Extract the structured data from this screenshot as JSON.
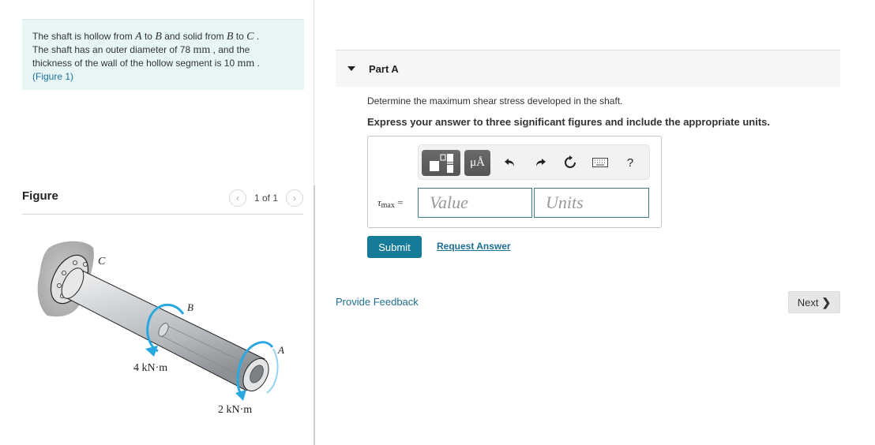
{
  "problem": {
    "line1_pre": "The shaft is hollow from ",
    "var_a": "A",
    "line1_mid1": " to ",
    "var_b": "B",
    "line1_mid2": " and solid from ",
    "var_b2": "B",
    "line1_mid3": " to ",
    "var_c": "C",
    "line1_end": " .",
    "line2_pre": "The shaft has an outer diameter of 78 ",
    "unit_mm": "mm",
    "line2_end": " , and the",
    "line3_pre": "thickness of the wall of the hollow segment is 10 ",
    "unit_mm2": "mm",
    "line3_end": " .",
    "figure_link": "(Figure 1)"
  },
  "figure": {
    "title": "Figure",
    "pager_text": "1 of 1",
    "prev_icon": "‹",
    "next_icon": "›",
    "labels": {
      "c": "C",
      "b": "B",
      "a": "A",
      "torque_b": "4 kN·m",
      "torque_a": "2 kN·m"
    }
  },
  "part": {
    "title": "Part A",
    "question": "Determine the maximum shear stress developed in the shaft.",
    "instructions": "Express your answer to three significant figures and include the appropriate units."
  },
  "answer": {
    "lhs_symbol": "τ",
    "lhs_sub": "max",
    "lhs_eq": " =",
    "value_placeholder": "Value",
    "units_placeholder": "Units",
    "value": "",
    "units": "",
    "toolbar": {
      "units_label": "μÅ",
      "undo_icon": "↶",
      "redo_icon": "↷",
      "reset_icon": "↻",
      "help_label": "?"
    }
  },
  "actions": {
    "submit": "Submit",
    "request_answer": "Request Answer",
    "provide_feedback": "Provide Feedback",
    "next": "Next",
    "next_icon": "❯"
  },
  "colors": {
    "accent": "#167a99",
    "link": "#1d6f95",
    "problem_bg": "#e8f5f5",
    "torque_arrow": "#29a8e0"
  }
}
